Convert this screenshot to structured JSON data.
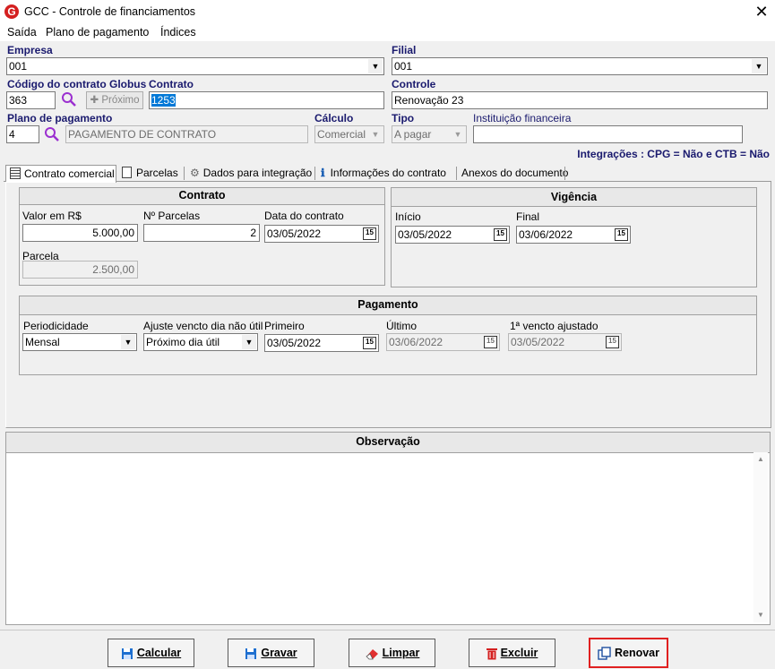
{
  "window": {
    "title": "GCC - Controle de financiamentos",
    "close_label": "✕"
  },
  "menu": {
    "items": [
      "Saída",
      "Plano de pagamento",
      "Índices"
    ]
  },
  "form": {
    "empresa_label": "Empresa",
    "empresa_value": "001",
    "filial_label": "Filial",
    "filial_value": "001",
    "codigo_label": "Código do contrato Globus",
    "codigo_value": "363",
    "proximo_label": "Próximo",
    "contrato_label": "Contrato",
    "contrato_value": "1253",
    "controle_label": "Controle",
    "controle_value": "Renovação 23",
    "plano_label": "Plano de pagamento",
    "plano_code": "4",
    "plano_desc": "PAGAMENTO DE CONTRATO",
    "calculo_label": "Cálculo",
    "calculo_value": "Comercial",
    "tipo_label": "Tipo",
    "tipo_value": "A pagar",
    "instituicao_label": "Instituição financeira",
    "instituicao_value": "",
    "integracoes_text": "Integrações : CPG = Não e CTB = Não"
  },
  "tabs": [
    {
      "label": "Contrato comercial",
      "icon": "document-list-icon"
    },
    {
      "label": "Parcelas",
      "icon": "document-icon"
    },
    {
      "label": "Dados para integração",
      "icon": "gear-icon"
    },
    {
      "label": "Informações do contrato",
      "icon": "info-icon"
    },
    {
      "label": "Anexos do documento",
      "icon": ""
    }
  ],
  "contrato_panel": {
    "title": "Contrato",
    "valor_label": "Valor em R$",
    "valor_value": "5.000,00",
    "nparcelas_label": "Nº Parcelas",
    "nparcelas_value": "2",
    "data_label": "Data do contrato",
    "data_value": "03/05/2022",
    "parcela_label": "Parcela",
    "parcela_value": "2.500,00"
  },
  "vigencia_panel": {
    "title": "Vigência",
    "inicio_label": "Início",
    "inicio_value": "03/05/2022",
    "final_label": "Final",
    "final_value": "03/06/2022"
  },
  "pagamento_panel": {
    "title": "Pagamento",
    "periodicidade_label": "Periodicidade",
    "periodicidade_value": "Mensal",
    "ajuste_label": "Ajuste vencto dia não útil",
    "ajuste_value": "Próximo dia útil",
    "primeiro_label": "Primeiro",
    "primeiro_value": "03/05/2022",
    "ultimo_label": "Último",
    "ultimo_value": "03/06/2022",
    "vencto_ajustado_label": "1ª vencto ajustado",
    "vencto_ajustado_value": "03/05/2022"
  },
  "observacao": {
    "title": "Observação",
    "text": ""
  },
  "calendar_icon_text": "15",
  "buttons": {
    "calcular": "Calcular",
    "gravar": "Gravar",
    "limpar": "Limpar",
    "excluir": "Excluir",
    "renovar": "Renovar"
  },
  "colors": {
    "label_blue": "#1a1a6e",
    "highlight_red": "#e02020",
    "logo_red": "#d42020"
  }
}
